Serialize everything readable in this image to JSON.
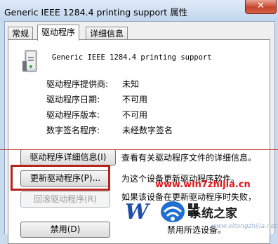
{
  "window": {
    "title": "Generic IEEE 1284.4 printing support 属性",
    "close_glyph": "✕"
  },
  "tabs": [
    {
      "label": "常规"
    },
    {
      "label": "驱动程序"
    },
    {
      "label": "详细信息"
    }
  ],
  "driver": {
    "name": "Generic IEEE 1284.4 printing support",
    "icon": "printer-icon",
    "fields": [
      {
        "label": "驱动程序提供商:",
        "value": "未知"
      },
      {
        "label": "驱动程序日期:",
        "value": "不可用"
      },
      {
        "label": "驱动程序版本:",
        "value": "不可用"
      },
      {
        "label": "数字签名程序:",
        "value": "未经数字签名"
      }
    ]
  },
  "actions": [
    {
      "label": "驱动程序详细信息(I)",
      "description": "查看有关驱动程序文件的详细信息。",
      "enabled": true
    },
    {
      "label": "更新驱动程序(P)...",
      "description": "为这个设备更新驱动程序软件。",
      "enabled": true
    },
    {
      "label": "回滚驱动程序(R)",
      "description": "如果该设备在更新驱动程序时失败，",
      "enabled": false
    },
    {
      "label": "禁用(D)",
      "description": "禁用所选设备。",
      "enabled": true
    }
  ],
  "watermark": {
    "url": "www.win7zhijia.cn",
    "brand": "系统之家",
    "site": "www.xitongzhijia.net"
  },
  "colors": {
    "highlight": "#b5231b",
    "watermark_red": "#e0161b",
    "title_bg": "#c9dbef"
  }
}
